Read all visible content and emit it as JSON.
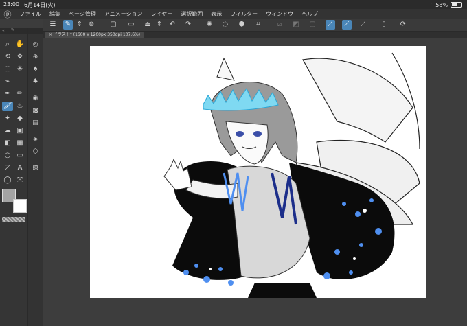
{
  "status": {
    "time": "23:00",
    "date": "6月14日(火)",
    "battery": "58%"
  },
  "menu": [
    "ファイル",
    "編集",
    "ページ管理",
    "アニメーション",
    "レイヤー",
    "選択範囲",
    "表示",
    "フィルター",
    "ウィンドウ",
    "ヘルプ"
  ],
  "tab": {
    "title": "イラスト* (1600 x 1200px 350dpi 107.6%)"
  },
  "icons": {
    "app_logo": "clip-studio-logo-icon",
    "tools": [
      "magnifier-icon",
      "hand-icon",
      "rotate-icon",
      "move-icon",
      "selection-rect-icon",
      "magic-wand-icon",
      "eyedropper-icon",
      "pen-icon",
      "pencil-icon",
      "brush-icon",
      "airbrush-icon",
      "blend-icon",
      "eraser-icon",
      "fill-icon",
      "gradient-icon",
      "shape-icon",
      "text-icon",
      "ruler-icon",
      "lasso-icon",
      "correction-icon"
    ]
  },
  "colors": {
    "main": "#a4a4a4",
    "sub": "#ffffff",
    "accent": "#4a86b8"
  },
  "illustration": {
    "subject": "fairy character with glowing blue crown",
    "palette": [
      "#7fd9f2",
      "#1c2e8a",
      "#4f8ff0",
      "#000000",
      "#bfbfbf"
    ]
  }
}
